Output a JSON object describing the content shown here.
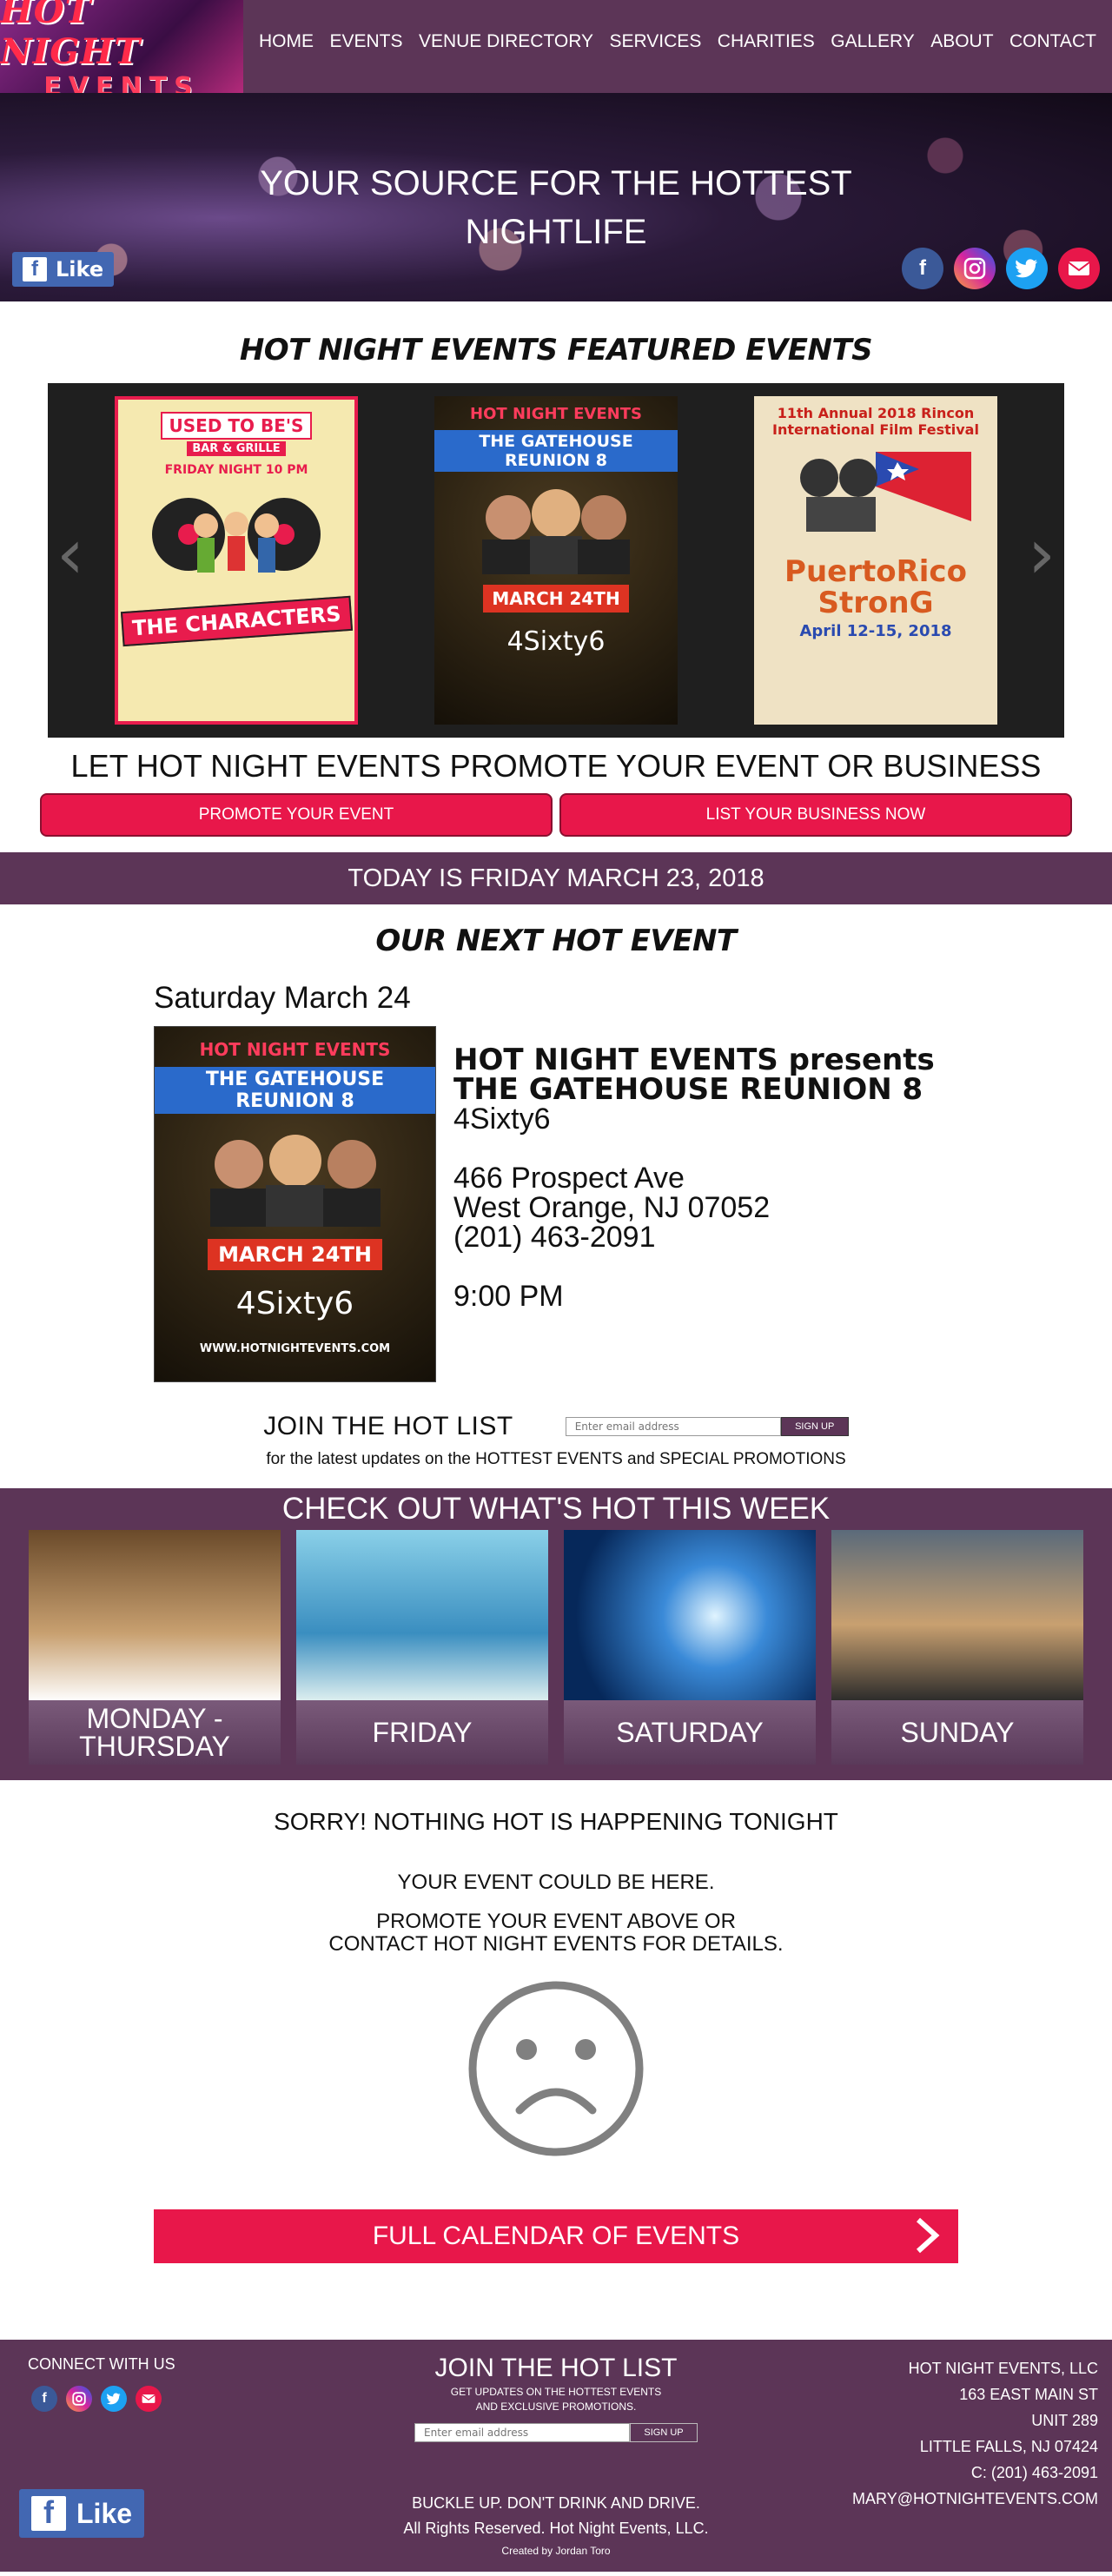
{
  "nav": {
    "logo_line1": "HOT NIGHT",
    "logo_line2": "EVENTS",
    "items": [
      {
        "label": "HOME"
      },
      {
        "label": "EVENTS"
      },
      {
        "label": "VENUE DIRECTORY"
      },
      {
        "label": "SERVICES"
      },
      {
        "label": "CHARITIES"
      },
      {
        "label": "GALLERY"
      },
      {
        "label": "ABOUT"
      },
      {
        "label": "CONTACT"
      }
    ]
  },
  "hero": {
    "headline_line1": "YOUR SOURCE FOR THE HOTTEST",
    "headline_line2": "NIGHTLIFE",
    "like_label": "Like",
    "social": [
      "facebook-icon",
      "instagram-icon",
      "twitter-icon",
      "email-icon"
    ]
  },
  "featured": {
    "title": "HOT NIGHT EVENTS FEATURED EVENTS",
    "flyers": [
      {
        "top": "USED TO BE'S",
        "sub": "BAR & GRILLE",
        "main": "THE CHARACTERS",
        "note": "FRIDAY NIGHT 10 PM"
      },
      {
        "top": "HOT NIGHT EVENTS",
        "main": "THE GATEHOUSE REUNION 8",
        "note": "MARCH 24TH",
        "sub": "4Sixty6"
      },
      {
        "top": "11th Annual 2018 Rincon International Film Festival",
        "main": "PuertoRico StronG",
        "note": "April 12-15, 2018"
      }
    ]
  },
  "promote": {
    "title": "LET HOT NIGHT EVENTS PROMOTE YOUR EVENT OR BUSINESS",
    "btn_event": "PROMOTE YOUR EVENT",
    "btn_business": "LIST YOUR BUSINESS NOW"
  },
  "today": "TODAY IS FRIDAY MARCH 23, 2018",
  "next_event": {
    "section_title": "OUR NEXT HOT EVENT",
    "date": "Saturday March 24",
    "presenter": "HOT NIGHT EVENTS presents",
    "title": "THE GATEHOUSE REUNION 8",
    "venue": "4Sixty6",
    "address1": "466 Prospect Ave",
    "address2": "West Orange, NJ 07052",
    "phone": "(201) 463-2091",
    "time": "9:00 PM",
    "flyer_top": "HOT NIGHT EVENTS",
    "flyer_main": "THE GATEHOUSE REUNION 8",
    "flyer_date": "MARCH 24TH",
    "flyer_venue": "4Sixty6",
    "flyer_site": "WWW.HOTNIGHTEVENTS.COM"
  },
  "hotlist": {
    "label": "JOIN THE HOT LIST",
    "placeholder": "Enter email address",
    "button": "SIGN UP",
    "sub": "for the latest updates on the HOTTEST EVENTS and SPECIAL PROMOTIONS"
  },
  "week": {
    "title": "CHECK OUT WHAT'S HOT THIS WEEK",
    "days": [
      {
        "label": "MONDAY - THURSDAY"
      },
      {
        "label": "FRIDAY"
      },
      {
        "label": "SATURDAY"
      },
      {
        "label": "SUNDAY"
      }
    ]
  },
  "tonight": {
    "sorry": "SORRY! NOTHING HOT IS HAPPENING TONIGHT",
    "line1": "YOUR EVENT COULD BE HERE.",
    "line2": "PROMOTE YOUR EVENT ABOVE OR",
    "line3": "CONTACT HOT NIGHT EVENTS FOR DETAILS.",
    "calendar_button": "FULL CALENDAR OF EVENTS"
  },
  "footer": {
    "connect": "CONNECT WITH US",
    "join_title": "JOIN THE HOT LIST",
    "join_sub1": "GET UPDATES ON THE HOTTEST EVENTS",
    "join_sub2": "AND EXCLUSIVE PROMOTIONS.",
    "placeholder": "Enter email address",
    "button": "SIGN UP",
    "buckle": "BUCKLE UP.  DON'T DRINK AND DRIVE.",
    "rights": "All Rights Reserved.  Hot Night Events, LLC.",
    "credit": "Created by Jordan Toro",
    "like_label": "Like",
    "company": "HOT NIGHT EVENTS, LLC",
    "street": "163 EAST MAIN ST",
    "unit": "UNIT 289",
    "city": "LITTLE FALLS, NJ 07424",
    "phone": "C: (201) 463-2091",
    "email": "MARY@HOTNIGHTEVENTS.COM"
  },
  "colors": {
    "brand_purple": "#5c3557",
    "accent_red": "#e8174a",
    "facebook_blue": "#4267b2"
  }
}
